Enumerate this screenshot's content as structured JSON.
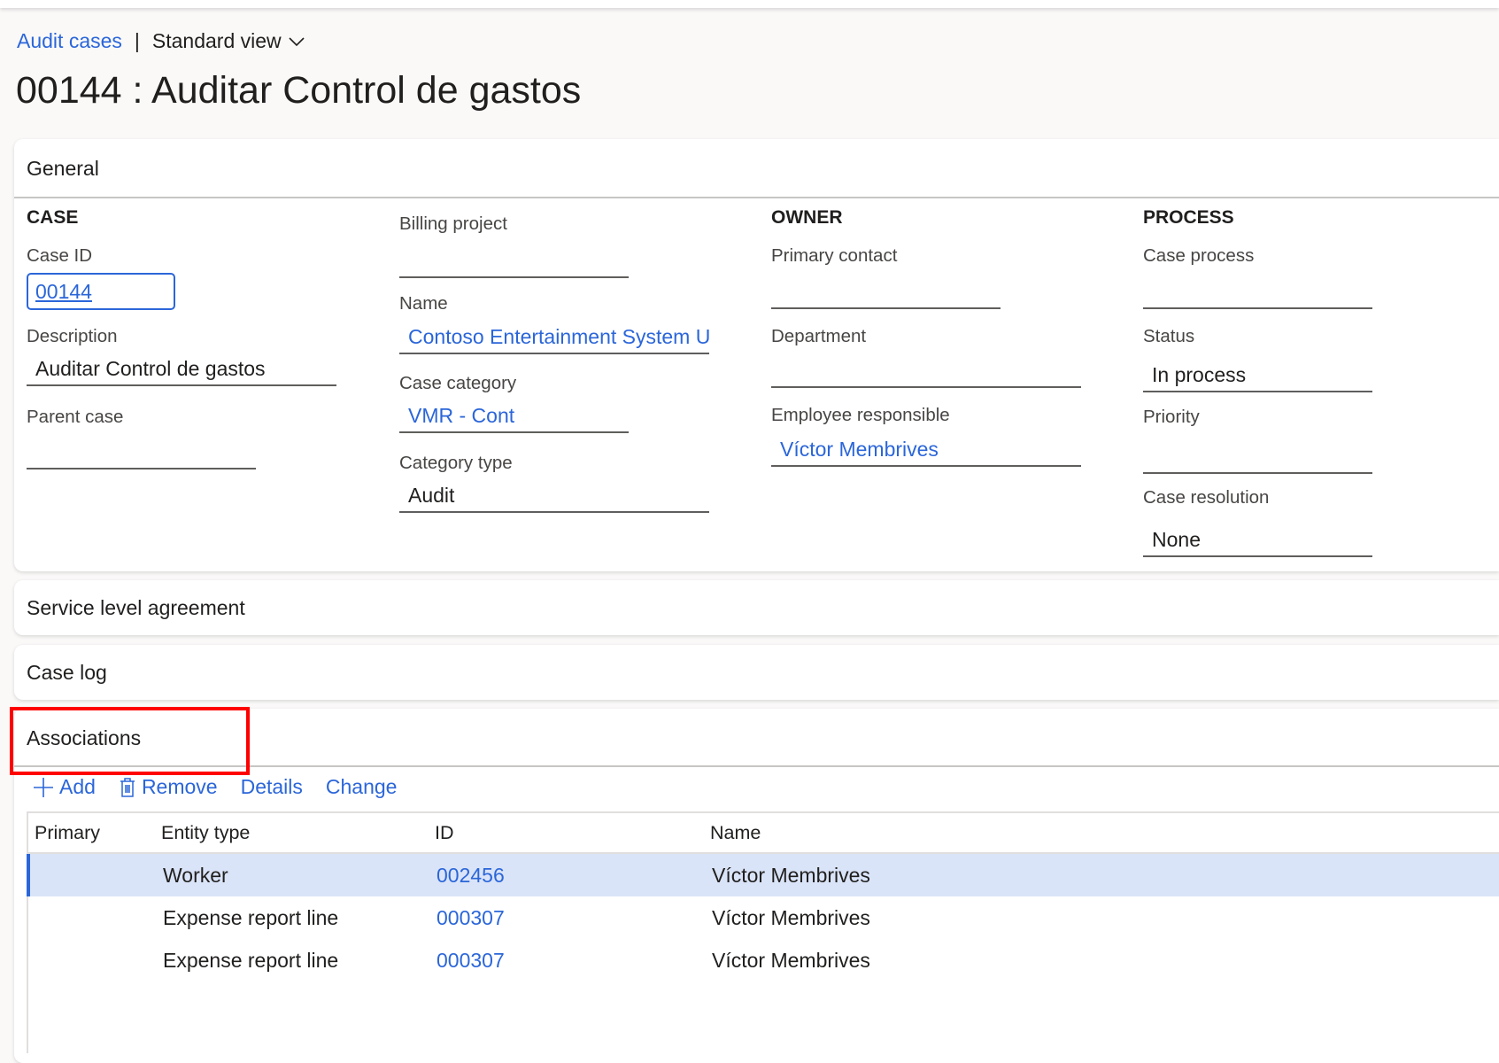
{
  "breadcrumb": {
    "link": "Audit cases",
    "separator": "|",
    "view": "Standard view"
  },
  "page_title": "00144 : Auditar Control de gastos",
  "general": {
    "header": "General",
    "case_group": {
      "title": "CASE",
      "case_id_label": "Case ID",
      "case_id_value": "00144",
      "description_label": "Description",
      "description_value": "Auditar Control de gastos",
      "parent_case_label": "Parent case",
      "parent_case_value": ""
    },
    "billing_group": {
      "billing_project_label": "Billing project",
      "billing_project_value": "",
      "name_label": "Name",
      "name_value": "Contoso Entertainment System U",
      "case_category_label": "Case category",
      "case_category_value": "VMR - Cont",
      "category_type_label": "Category type",
      "category_type_value": "Audit"
    },
    "owner_group": {
      "title": "OWNER",
      "primary_contact_label": "Primary contact",
      "primary_contact_value": "",
      "department_label": "Department",
      "department_value": "",
      "employee_responsible_label": "Employee responsible",
      "employee_responsible_value": "Víctor Membrives"
    },
    "process_group": {
      "title": "PROCESS",
      "case_process_label": "Case process",
      "case_process_value": "",
      "status_label": "Status",
      "status_value": "In process",
      "priority_label": "Priority",
      "priority_value": "",
      "case_resolution_label": "Case resolution",
      "case_resolution_value": "None"
    }
  },
  "sections": {
    "sla": "Service level agreement",
    "case_log": "Case log",
    "associations": "Associations"
  },
  "associations": {
    "toolbar": {
      "add": "Add",
      "remove": "Remove",
      "details": "Details",
      "change": "Change"
    },
    "columns": [
      "Primary",
      "Entity type",
      "ID",
      "Name"
    ],
    "rows": [
      {
        "primary": "",
        "entity_type": "Worker",
        "id": "002456",
        "name": "Víctor Membrives",
        "selected": true
      },
      {
        "primary": "",
        "entity_type": "Expense report line",
        "id": "000307",
        "name": "Víctor Membrives",
        "selected": false
      },
      {
        "primary": "",
        "entity_type": "Expense report line",
        "id": "000307",
        "name": "Víctor Membrives",
        "selected": false
      }
    ]
  },
  "colors": {
    "accent": "#2b66d9",
    "highlight_box": "#ff0000",
    "selected_row": "#dae4f8"
  }
}
